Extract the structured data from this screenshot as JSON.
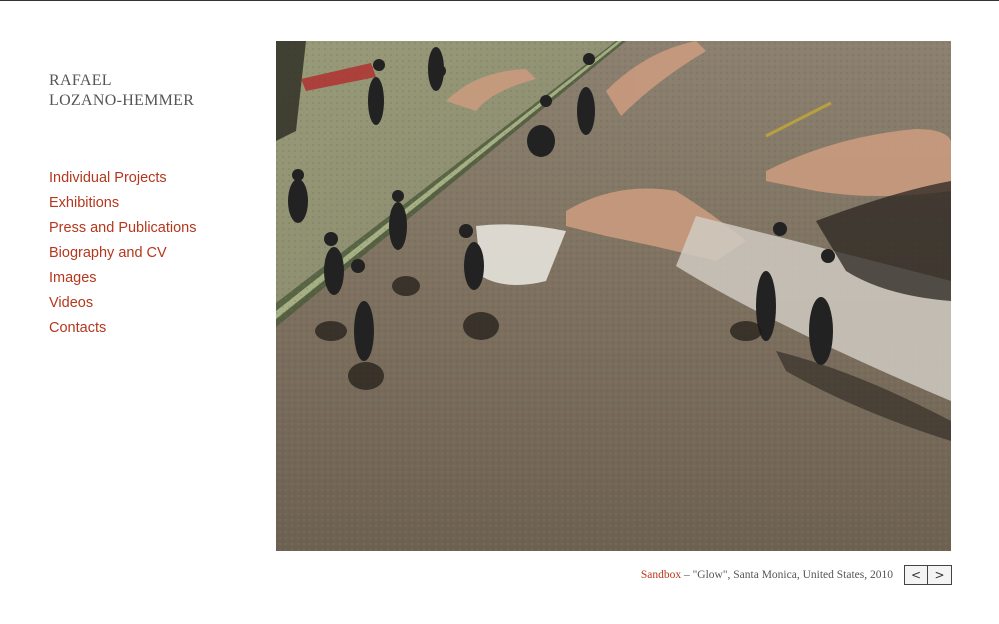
{
  "site": {
    "title_line1": "RAFAEL",
    "title_line2": "LOZANO-HEMMER"
  },
  "nav": {
    "items": [
      {
        "label": "Individual Projects"
      },
      {
        "label": "Exhibitions"
      },
      {
        "label": "Press and Publications"
      },
      {
        "label": "Biography and CV"
      },
      {
        "label": "Images"
      },
      {
        "label": "Videos"
      },
      {
        "label": "Contacts"
      }
    ]
  },
  "photo": {
    "alt": "Sandbox installation: projected giant hands on a beach with people walking"
  },
  "caption": {
    "project": "Sandbox",
    "separator": " – ",
    "details": "\"Glow\", Santa Monica, United States, 2010"
  },
  "pager": {
    "prev_label": "<",
    "next_label": ">"
  },
  "colors": {
    "link": "#b5371d",
    "title": "#555555"
  }
}
